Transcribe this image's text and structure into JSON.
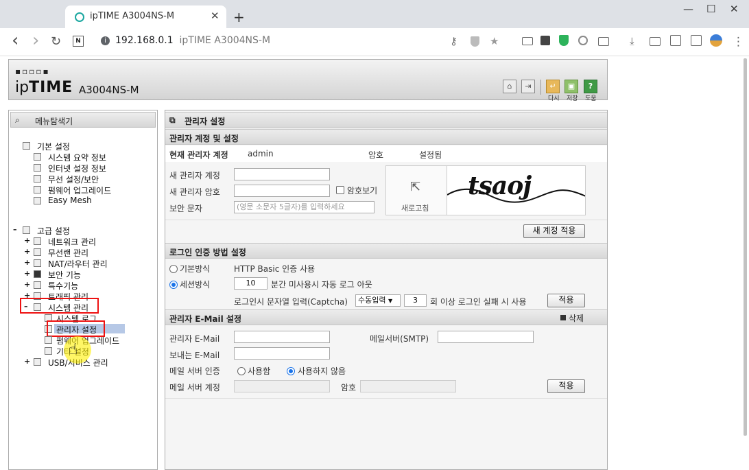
{
  "browser": {
    "tab_title": "ipTIME A3004NS-M",
    "new_tab": "+",
    "close_tab": "✕",
    "win_min": "—",
    "win_max": "☐",
    "win_close": "✕",
    "url_host": "192.168.0.1",
    "url_rest": "ipTIME A3004NS-M",
    "nav_back": "‹",
    "nav_forward": "›",
    "nav_reload": "↻",
    "nav_n": "N",
    "icon_key": "⚷",
    "icon_star": "★",
    "icon_download": "⤓",
    "icon_more": "⋮"
  },
  "router": {
    "logo_dots": "▪▫▫▫▪",
    "logo_ip": "ip",
    "logo_time": "TIME",
    "model": "A3004NS-M",
    "header_buttons": [
      {
        "icon": "⌂",
        "label": ""
      },
      {
        "icon": "⇥",
        "label": ""
      },
      {
        "icon": "↵",
        "label": "다시"
      },
      {
        "icon": "▣",
        "label": "저장"
      },
      {
        "icon": "?",
        "label": "도움"
      }
    ]
  },
  "left": {
    "title": "메뉴탐색기",
    "basic": {
      "label": "기본 설정",
      "items": [
        "시스템 요약 정보",
        "인터넷 설정 정보",
        "무선 설정/보안",
        "펌웨어 업그레이드",
        "Easy Mesh"
      ]
    },
    "advanced": {
      "label": "고급 설정",
      "expander": "–",
      "items": [
        "네트워크 관리",
        "무선랜 관리",
        "NAT/라우터 관리",
        "보안 기능",
        "특수기능",
        "트래픽 관리"
      ]
    },
    "system": {
      "label": "시스템 관리",
      "expander": "–",
      "items": [
        "시스템 로그",
        "관리자 설정",
        "펌웨어 업그레이드",
        "기타 설정"
      ]
    },
    "usb": {
      "label": "USB/서비스 관리"
    },
    "plus": "+"
  },
  "main": {
    "title": "관리자 설정",
    "account_section": "관리자 계정 및 설정",
    "current_account_label": "현재 관리자 계정",
    "current_account_value": "admin",
    "password_label": "암호",
    "password_status": "설정됨",
    "new_account_label": "새 관리자 계정",
    "new_password_label": "새 관리자 암호",
    "show_password_label": "암호보기",
    "security_text_label": "보안 문자",
    "security_text_placeholder": "(영문 소문자 5글자)를 입력하세요",
    "refresh_label": "새로고침",
    "captcha_text": "tsaoj",
    "apply_account_button": "새 계정 적용",
    "login_section": "로그인 인증 방법 설정",
    "basic_method_label": "기본방식",
    "basic_method_desc": "HTTP Basic 인증 사용",
    "session_method_label": "세션방식",
    "session_minutes": "10",
    "session_desc": "분간 미사용시 자동 로그 아웃",
    "captcha_desc": "로그인시 문자열 입력(Captcha)",
    "captcha_mode": "수동입력",
    "captcha_count": "3",
    "captcha_fail_desc": "회 이상 로그인 실패 시 사용",
    "apply_button": "적용",
    "email_section": "관리자 E-Mail 설정",
    "delete_label": "삭제",
    "admin_email_label": "관리자 E-Mail",
    "smtp_label": "메일서버(SMTP)",
    "sender_email_label": "보내는 E-Mail",
    "mail_auth_label": "메일 서버 인증",
    "use_label": "사용함",
    "not_use_label": "사용하지 않음",
    "mail_account_label": "메일 서버 계정",
    "mail_password_label": "암호"
  },
  "colors": {
    "highlight_box": "#e11111",
    "selected_bg": "#b6c8e6",
    "radio_on": "#1a73e8"
  }
}
